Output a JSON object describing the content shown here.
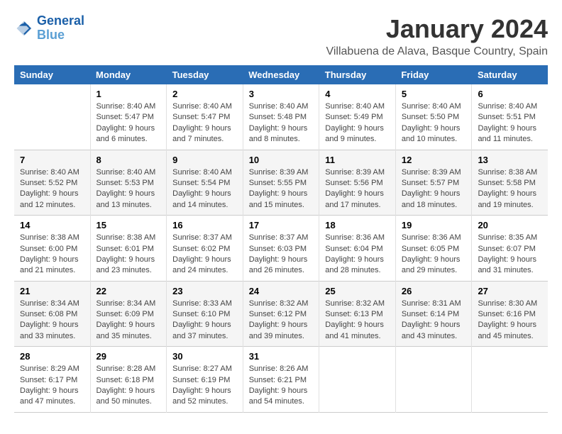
{
  "header": {
    "logo_line1": "General",
    "logo_line2": "Blue",
    "main_title": "January 2024",
    "subtitle": "Villabuena de Alava, Basque Country, Spain"
  },
  "days_of_week": [
    "Sunday",
    "Monday",
    "Tuesday",
    "Wednesday",
    "Thursday",
    "Friday",
    "Saturday"
  ],
  "weeks": [
    [
      {
        "day": "",
        "lines": []
      },
      {
        "day": "1",
        "lines": [
          "Sunrise: 8:40 AM",
          "Sunset: 5:47 PM",
          "Daylight: 9 hours",
          "and 6 minutes."
        ]
      },
      {
        "day": "2",
        "lines": [
          "Sunrise: 8:40 AM",
          "Sunset: 5:47 PM",
          "Daylight: 9 hours",
          "and 7 minutes."
        ]
      },
      {
        "day": "3",
        "lines": [
          "Sunrise: 8:40 AM",
          "Sunset: 5:48 PM",
          "Daylight: 9 hours",
          "and 8 minutes."
        ]
      },
      {
        "day": "4",
        "lines": [
          "Sunrise: 8:40 AM",
          "Sunset: 5:49 PM",
          "Daylight: 9 hours",
          "and 9 minutes."
        ]
      },
      {
        "day": "5",
        "lines": [
          "Sunrise: 8:40 AM",
          "Sunset: 5:50 PM",
          "Daylight: 9 hours",
          "and 10 minutes."
        ]
      },
      {
        "day": "6",
        "lines": [
          "Sunrise: 8:40 AM",
          "Sunset: 5:51 PM",
          "Daylight: 9 hours",
          "and 11 minutes."
        ]
      }
    ],
    [
      {
        "day": "7",
        "lines": [
          "Sunrise: 8:40 AM",
          "Sunset: 5:52 PM",
          "Daylight: 9 hours",
          "and 12 minutes."
        ]
      },
      {
        "day": "8",
        "lines": [
          "Sunrise: 8:40 AM",
          "Sunset: 5:53 PM",
          "Daylight: 9 hours",
          "and 13 minutes."
        ]
      },
      {
        "day": "9",
        "lines": [
          "Sunrise: 8:40 AM",
          "Sunset: 5:54 PM",
          "Daylight: 9 hours",
          "and 14 minutes."
        ]
      },
      {
        "day": "10",
        "lines": [
          "Sunrise: 8:39 AM",
          "Sunset: 5:55 PM",
          "Daylight: 9 hours",
          "and 15 minutes."
        ]
      },
      {
        "day": "11",
        "lines": [
          "Sunrise: 8:39 AM",
          "Sunset: 5:56 PM",
          "Daylight: 9 hours",
          "and 17 minutes."
        ]
      },
      {
        "day": "12",
        "lines": [
          "Sunrise: 8:39 AM",
          "Sunset: 5:57 PM",
          "Daylight: 9 hours",
          "and 18 minutes."
        ]
      },
      {
        "day": "13",
        "lines": [
          "Sunrise: 8:38 AM",
          "Sunset: 5:58 PM",
          "Daylight: 9 hours",
          "and 19 minutes."
        ]
      }
    ],
    [
      {
        "day": "14",
        "lines": [
          "Sunrise: 8:38 AM",
          "Sunset: 6:00 PM",
          "Daylight: 9 hours",
          "and 21 minutes."
        ]
      },
      {
        "day": "15",
        "lines": [
          "Sunrise: 8:38 AM",
          "Sunset: 6:01 PM",
          "Daylight: 9 hours",
          "and 23 minutes."
        ]
      },
      {
        "day": "16",
        "lines": [
          "Sunrise: 8:37 AM",
          "Sunset: 6:02 PM",
          "Daylight: 9 hours",
          "and 24 minutes."
        ]
      },
      {
        "day": "17",
        "lines": [
          "Sunrise: 8:37 AM",
          "Sunset: 6:03 PM",
          "Daylight: 9 hours",
          "and 26 minutes."
        ]
      },
      {
        "day": "18",
        "lines": [
          "Sunrise: 8:36 AM",
          "Sunset: 6:04 PM",
          "Daylight: 9 hours",
          "and 28 minutes."
        ]
      },
      {
        "day": "19",
        "lines": [
          "Sunrise: 8:36 AM",
          "Sunset: 6:05 PM",
          "Daylight: 9 hours",
          "and 29 minutes."
        ]
      },
      {
        "day": "20",
        "lines": [
          "Sunrise: 8:35 AM",
          "Sunset: 6:07 PM",
          "Daylight: 9 hours",
          "and 31 minutes."
        ]
      }
    ],
    [
      {
        "day": "21",
        "lines": [
          "Sunrise: 8:34 AM",
          "Sunset: 6:08 PM",
          "Daylight: 9 hours",
          "and 33 minutes."
        ]
      },
      {
        "day": "22",
        "lines": [
          "Sunrise: 8:34 AM",
          "Sunset: 6:09 PM",
          "Daylight: 9 hours",
          "and 35 minutes."
        ]
      },
      {
        "day": "23",
        "lines": [
          "Sunrise: 8:33 AM",
          "Sunset: 6:10 PM",
          "Daylight: 9 hours",
          "and 37 minutes."
        ]
      },
      {
        "day": "24",
        "lines": [
          "Sunrise: 8:32 AM",
          "Sunset: 6:12 PM",
          "Daylight: 9 hours",
          "and 39 minutes."
        ]
      },
      {
        "day": "25",
        "lines": [
          "Sunrise: 8:32 AM",
          "Sunset: 6:13 PM",
          "Daylight: 9 hours",
          "and 41 minutes."
        ]
      },
      {
        "day": "26",
        "lines": [
          "Sunrise: 8:31 AM",
          "Sunset: 6:14 PM",
          "Daylight: 9 hours",
          "and 43 minutes."
        ]
      },
      {
        "day": "27",
        "lines": [
          "Sunrise: 8:30 AM",
          "Sunset: 6:16 PM",
          "Daylight: 9 hours",
          "and 45 minutes."
        ]
      }
    ],
    [
      {
        "day": "28",
        "lines": [
          "Sunrise: 8:29 AM",
          "Sunset: 6:17 PM",
          "Daylight: 9 hours",
          "and 47 minutes."
        ]
      },
      {
        "day": "29",
        "lines": [
          "Sunrise: 8:28 AM",
          "Sunset: 6:18 PM",
          "Daylight: 9 hours",
          "and 50 minutes."
        ]
      },
      {
        "day": "30",
        "lines": [
          "Sunrise: 8:27 AM",
          "Sunset: 6:19 PM",
          "Daylight: 9 hours",
          "and 52 minutes."
        ]
      },
      {
        "day": "31",
        "lines": [
          "Sunrise: 8:26 AM",
          "Sunset: 6:21 PM",
          "Daylight: 9 hours",
          "and 54 minutes."
        ]
      },
      {
        "day": "",
        "lines": []
      },
      {
        "day": "",
        "lines": []
      },
      {
        "day": "",
        "lines": []
      }
    ]
  ]
}
